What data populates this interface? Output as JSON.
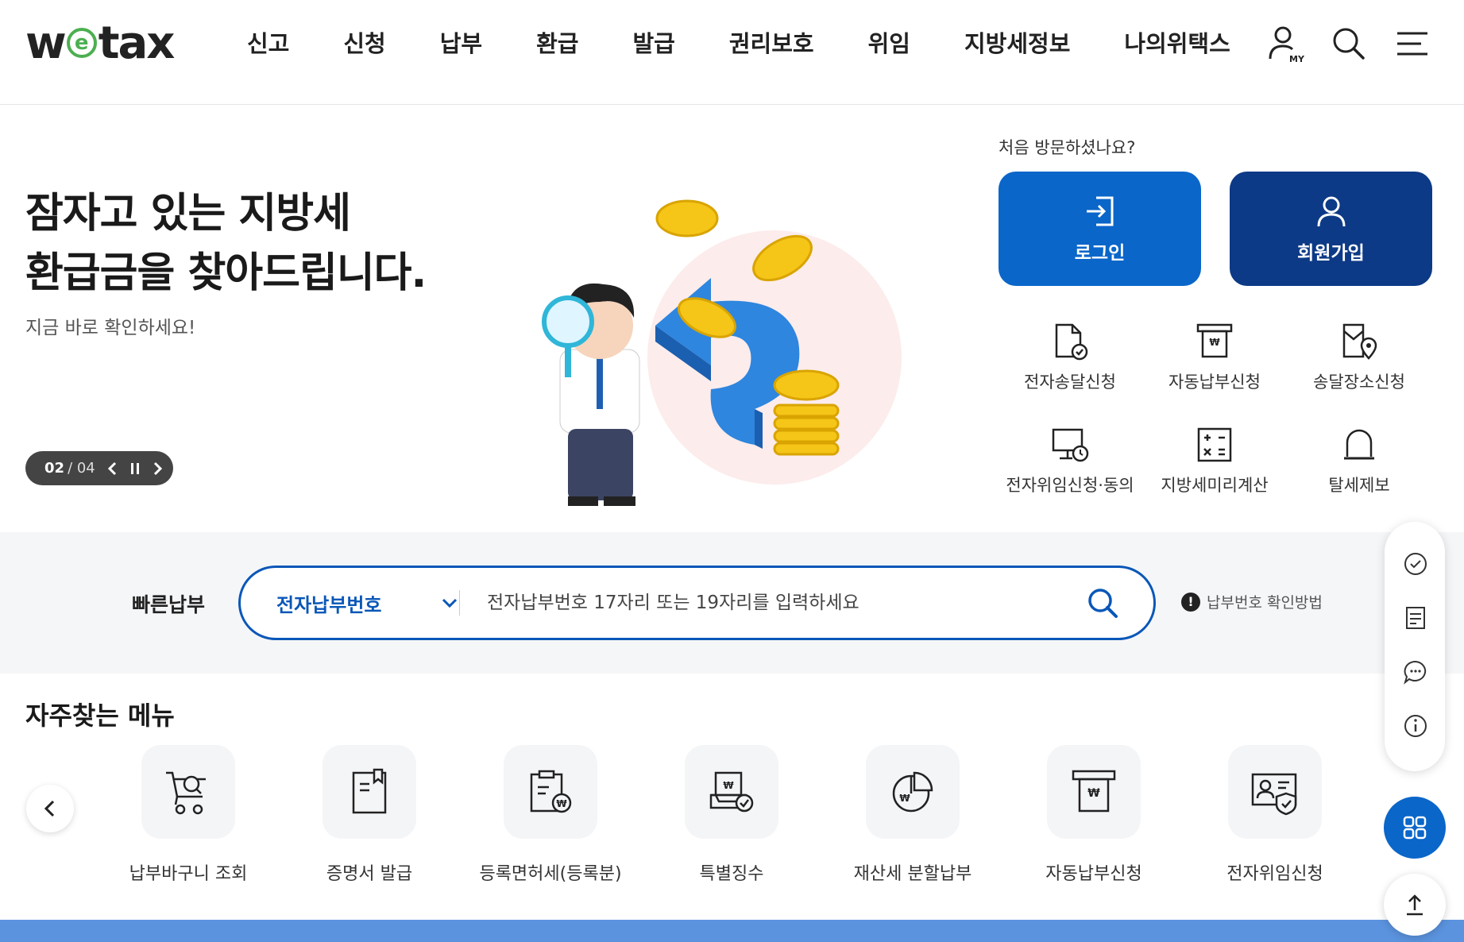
{
  "header": {
    "logo_left": "w",
    "logo_e": "e",
    "logo_right": "tax",
    "nav": [
      "신고",
      "신청",
      "납부",
      "환급",
      "발급",
      "권리보호",
      "위임",
      "지방세정보",
      "나의위택스"
    ],
    "icons": [
      "my-user-icon",
      "search-icon",
      "menu-icon"
    ],
    "my_badge": "MY"
  },
  "hero": {
    "title_line1": "잠자고 있는 지방세",
    "title_line2": "환급금을 찾아드립니다.",
    "subtitle": "지금 바로 확인하세요!",
    "slide_current": "02",
    "slide_sep": " / ",
    "slide_total": "04"
  },
  "account": {
    "first_visit": "처음 방문하셨나요?",
    "login": "로그인",
    "join": "회원가입",
    "colors": {
      "login": "#0a66c9",
      "join": "#0d3a86"
    }
  },
  "services": [
    {
      "label": "전자송달신청",
      "icon": "document-check-icon"
    },
    {
      "label": "자동납부신청",
      "icon": "atm-won-icon"
    },
    {
      "label": "송달장소신청",
      "icon": "document-location-icon"
    },
    {
      "label": "전자위임신청·동의",
      "icon": "monitor-clock-icon"
    },
    {
      "label": "지방세미리계산",
      "icon": "calculator-icon"
    },
    {
      "label": "탈세제보",
      "icon": "siren-icon"
    }
  ],
  "quick_pay": {
    "label": "빠른납부",
    "select_value": "전자납부번호",
    "placeholder": "전자납부번호 17자리 또는 19자리를 입력하세요",
    "help": "납부번호 확인방법"
  },
  "favorites": {
    "title": "자주찾는 메뉴",
    "items": [
      {
        "label": "납부바구니 조회",
        "icon": "cart-search-icon"
      },
      {
        "label": "증명서 발급",
        "icon": "certificate-icon"
      },
      {
        "label": "등록면허세(등록분)",
        "icon": "clipboard-won-icon"
      },
      {
        "label": "특별징수",
        "icon": "document-won-check-icon"
      },
      {
        "label": "재산세 분할납부",
        "icon": "pie-chart-won-icon"
      },
      {
        "label": "자동납부신청",
        "icon": "atm-won-icon"
      },
      {
        "label": "전자위임신청",
        "icon": "id-card-shield-icon"
      }
    ]
  },
  "side": {
    "icons": [
      "chat-check-icon",
      "receipt-icon",
      "chat-bubble-icon",
      "info-icon"
    ],
    "menu_icon": "grid-icon",
    "top_icon": "arrow-up-icon"
  }
}
